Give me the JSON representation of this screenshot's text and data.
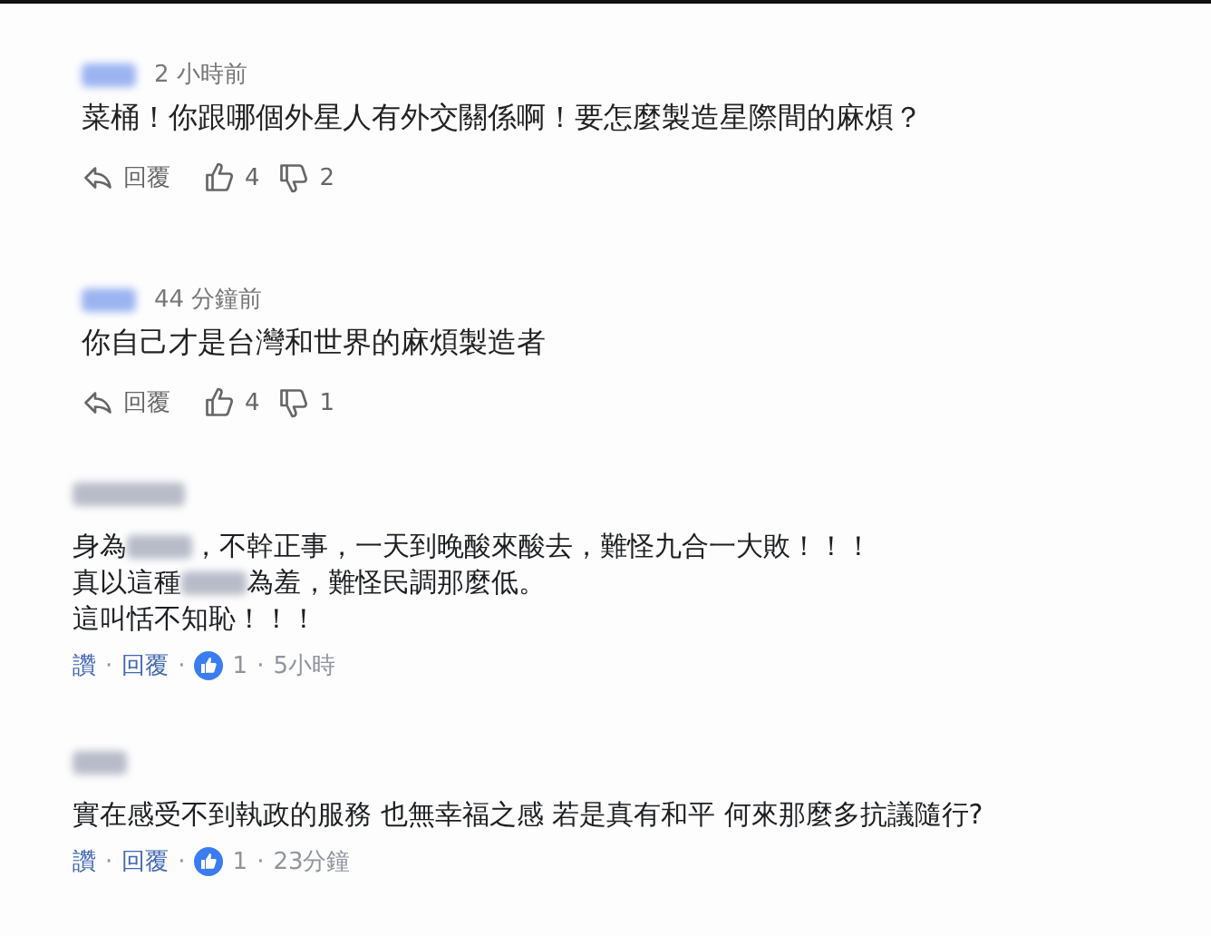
{
  "comments": [
    {
      "kind": "vote",
      "author": {
        "kind": "redacted"
      },
      "time": "2 小時前",
      "lines": [
        [
          {
            "kind": "text",
            "text": "菜桶！你跟哪個外星人有外交關係啊！要怎麼製造星際間的麻煩？"
          }
        ]
      ],
      "reply": "回覆",
      "likes": "4",
      "dislikes": "2"
    },
    {
      "kind": "vote",
      "author": {
        "kind": "redacted"
      },
      "time": "44 分鐘前",
      "lines": [
        [
          {
            "kind": "text",
            "text": "你自己才是台灣和世界的麻煩製造者"
          }
        ]
      ],
      "reply": "回覆",
      "likes": "4",
      "dislikes": "1"
    },
    {
      "kind": "reaction",
      "author": {
        "kind": "redacted"
      },
      "lines": [
        [
          {
            "kind": "text",
            "text": "身為"
          },
          {
            "kind": "redacted"
          },
          {
            "kind": "text",
            "text": "，不幹正事，一天到晚酸來酸去，難怪九合一大敗！！！"
          }
        ],
        [
          {
            "kind": "text",
            "text": "真以這種"
          },
          {
            "kind": "redacted"
          },
          {
            "kind": "text",
            "text": "為羞，難怪民調那麼低。"
          }
        ],
        [
          {
            "kind": "text",
            "text": "這叫恬不知恥！！！"
          }
        ]
      ],
      "like": "讚",
      "reply": "回覆",
      "reactions": "1",
      "time": "5小時",
      "separators": [
        "·",
        "·",
        "·"
      ]
    },
    {
      "kind": "reaction",
      "author": {
        "kind": "redacted"
      },
      "lines": [
        [
          {
            "kind": "text",
            "text": "實在感受不到執政的服務 也無幸福之感 若是真有和平 何來那麼多抗議隨行?"
          }
        ]
      ],
      "like": "讚",
      "reply": "回覆",
      "reactions": "1",
      "time": "23分鐘",
      "separators": [
        "·",
        "·",
        "·"
      ]
    }
  ]
}
